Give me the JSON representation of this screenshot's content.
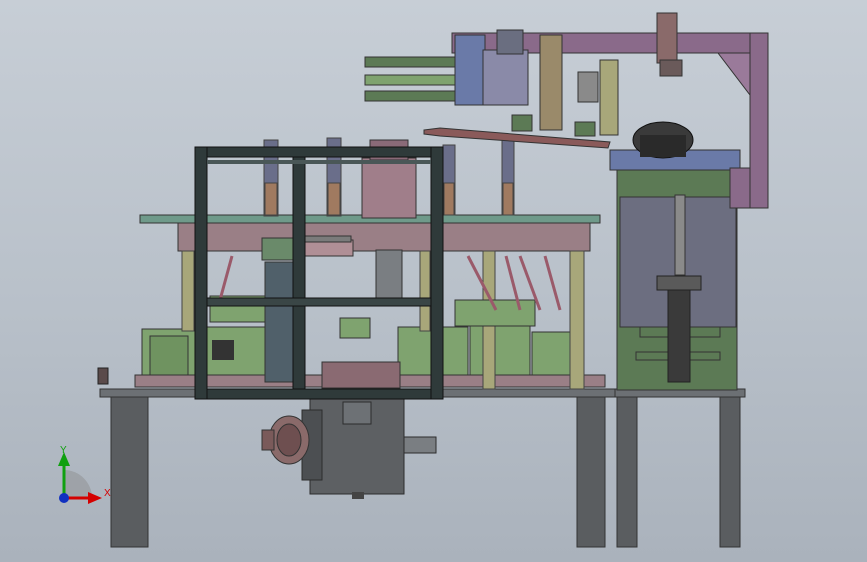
{
  "viewport": {
    "background_top": "#c7ced6",
    "background_bottom": "#aab2bc"
  },
  "triad": {
    "x_label": "X",
    "y_label": "Y",
    "x_color": "#d40000",
    "y_color": "#10a010",
    "z_color": "#1030c0"
  },
  "model_colors": {
    "frame_dark": "#2f3a3a",
    "frame_green": "#5c7a55",
    "plate_pink": "#9a7f86",
    "plate_green": "#7fa36f",
    "rod_olive": "#a8a77a",
    "plate_purple": "#8a6a8a",
    "steel_gray": "#6c7074",
    "base_gray": "#5a5d60",
    "rail_blue": "#6a7aa8"
  }
}
